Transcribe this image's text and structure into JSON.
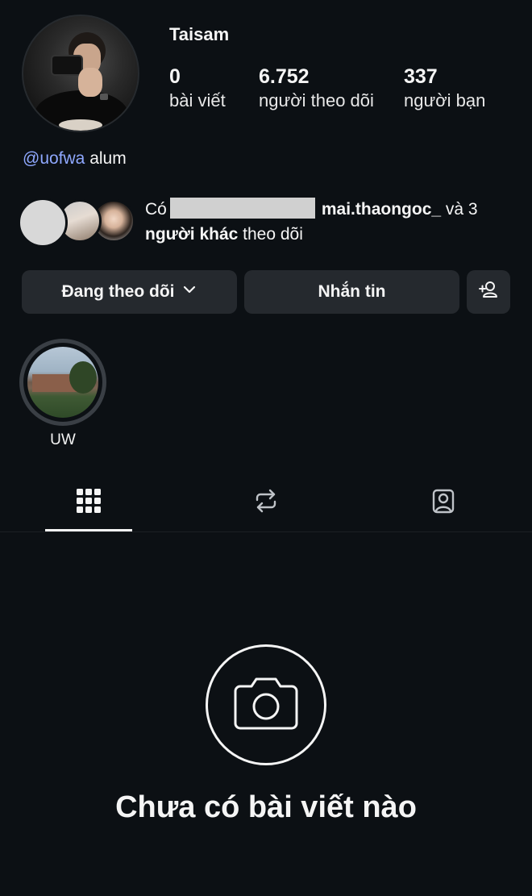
{
  "profile": {
    "username": "Taisam",
    "stats": [
      {
        "value": "0",
        "label": "bài viết"
      },
      {
        "value": "6.752",
        "label": "người theo dõi"
      },
      {
        "value": "337",
        "label": "người bạn"
      }
    ],
    "bio_mention": "@uofwa",
    "bio_text": " alum"
  },
  "followed_by": {
    "prefix": "Có",
    "user": "mai.thaongoc_",
    "and_text": " và 3",
    "others": "người khác",
    "suffix": " theo dõi"
  },
  "actions": {
    "following_label": "Đang theo dõi",
    "message_label": "Nhắn tin"
  },
  "highlights": [
    {
      "label": "UW"
    }
  ],
  "empty_state": {
    "title": "Chưa có bài viết nào"
  },
  "colors": {
    "background": "#0c1014",
    "button": "#25292e",
    "mention": "#8fa8ff"
  }
}
